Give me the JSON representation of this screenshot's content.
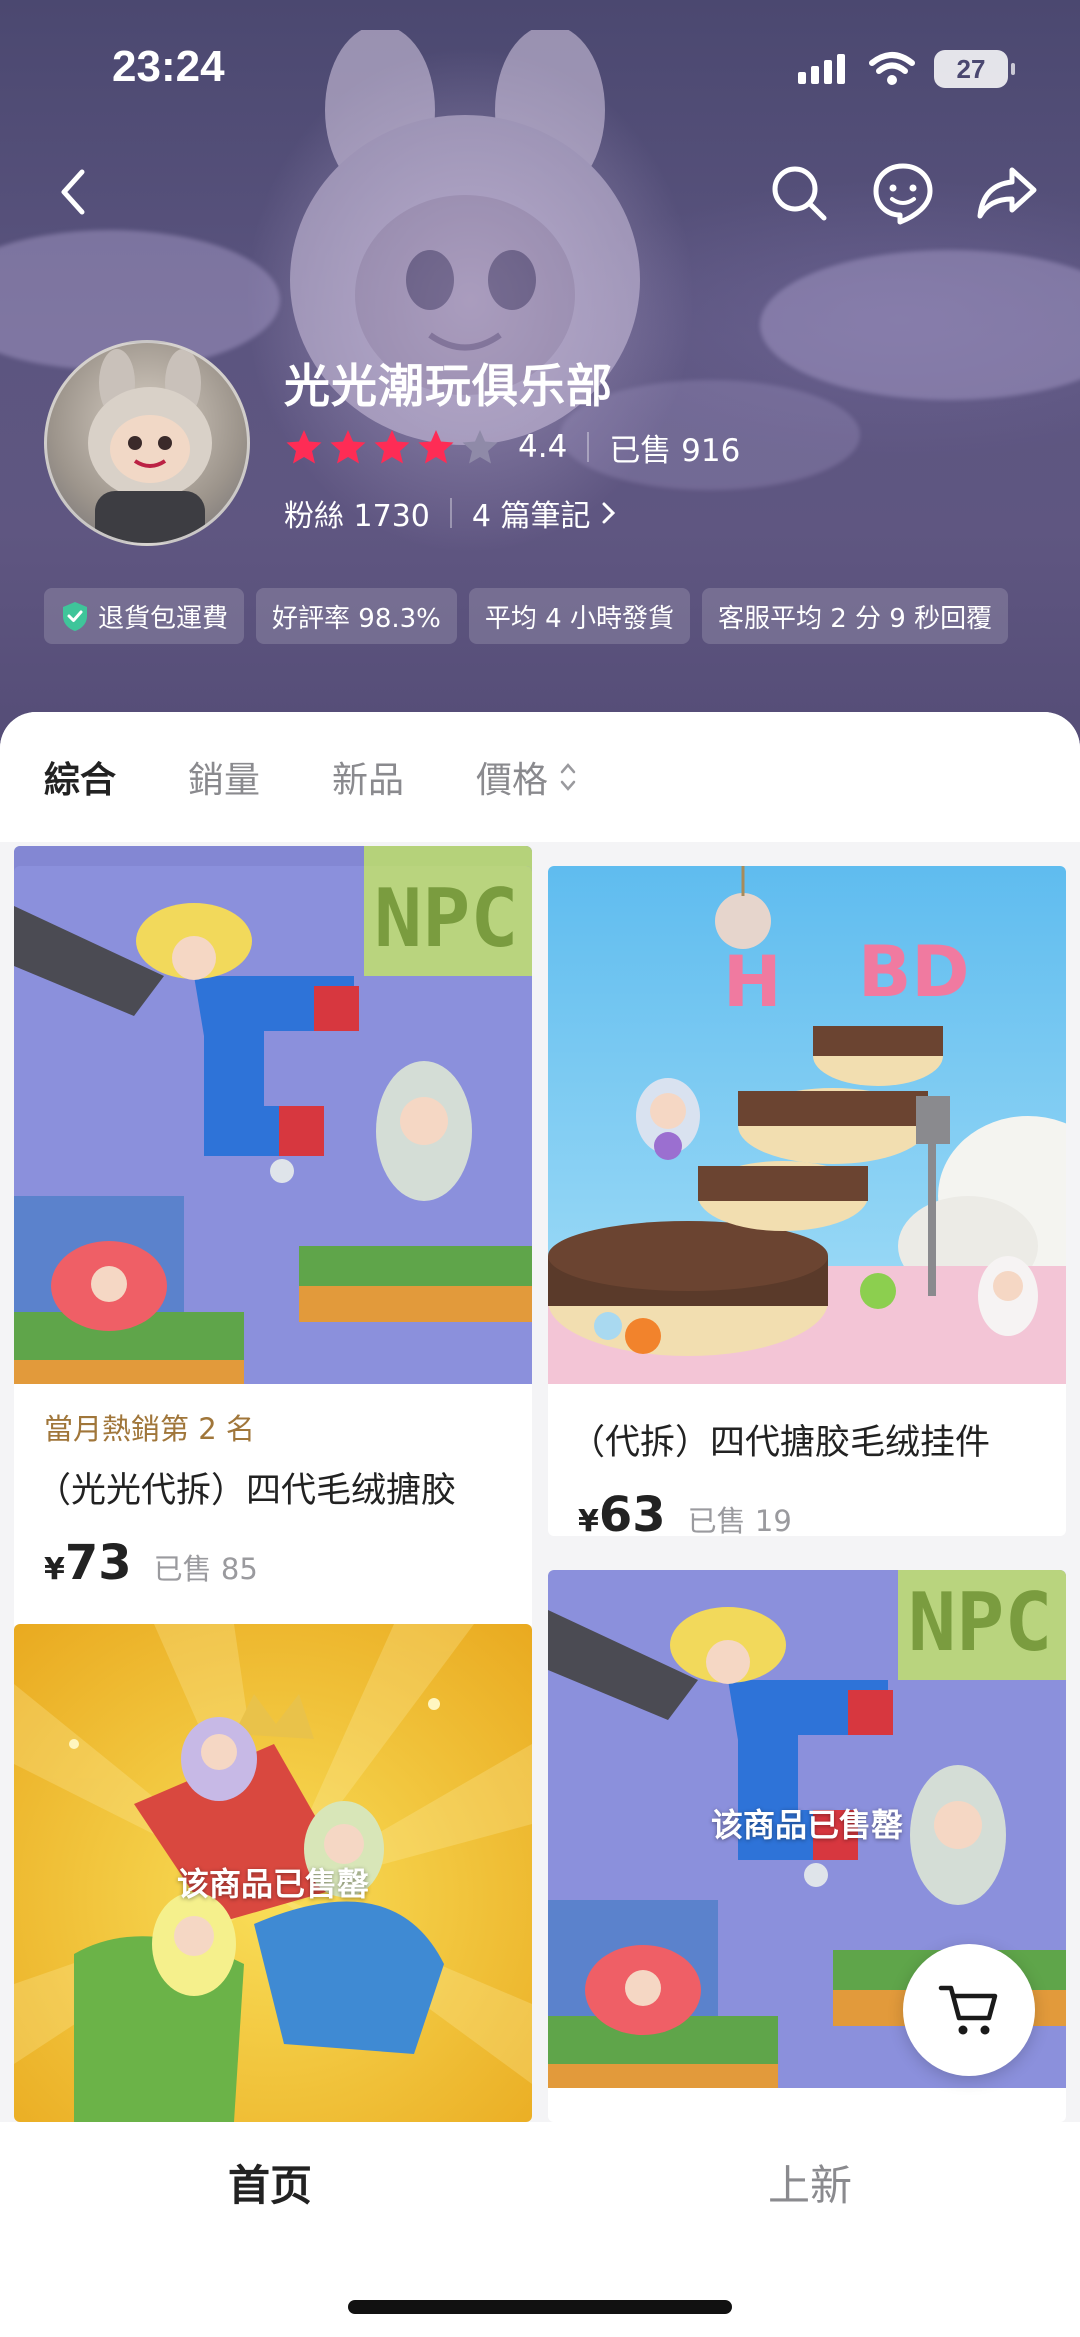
{
  "status_bar": {
    "time": "23:24",
    "battery": "27"
  },
  "nav": {
    "icons": [
      "back-icon",
      "search-icon",
      "customer-service-icon",
      "share-icon"
    ]
  },
  "shop": {
    "name": "光光潮玩俱乐部",
    "rating": "4.4",
    "rating_stars": 4,
    "sold": "已售 916",
    "fans": "粉絲 1730",
    "notes": "4 篇筆記"
  },
  "badges": [
    "退貨包運費",
    "好評率 98.3%",
    "平均 4 小時發貨",
    "客服平均 2 分 9 秒回覆"
  ],
  "sort_tabs": {
    "comprehensive": "綜合",
    "sales": "銷量",
    "new": "新品",
    "price": "價格"
  },
  "products": [
    {
      "rank": "當月熱銷第 2 名",
      "title": "（光光代拆）四代毛绒搪胶",
      "currency": "¥",
      "price": "73",
      "sold": "已售 85"
    },
    {
      "title": "（代拆）四代搪胶毛绒挂件",
      "currency": "¥",
      "price": "63",
      "sold": "已售 19"
    },
    {
      "status": "该商品已售罄"
    },
    {
      "status": "该商品已售罄"
    }
  ],
  "bottom_tabs": {
    "home": "首页",
    "new": "上新"
  },
  "colors": {
    "star_active": "#fe2c55",
    "star_inactive": "#8f8aa8",
    "hero_bg": "#5c5580",
    "badge_check": "#3fc59a",
    "rank_text": "#a0763a"
  }
}
